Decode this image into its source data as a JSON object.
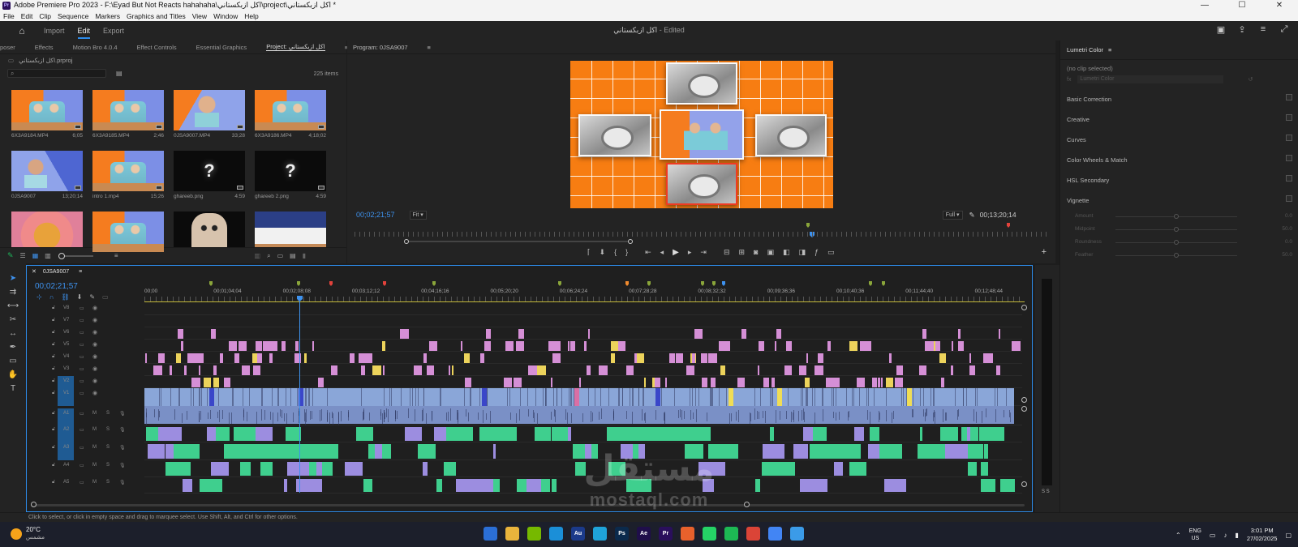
{
  "window": {
    "title": "Adobe Premiere Pro 2023 - F:\\Eyad But Not Reacts hahahaha\\اكل ازبكستاني\\project\\اكل ازبكستاني *",
    "app_icon": "Pr",
    "minimize": "—",
    "maximize": "☐",
    "close": "✕"
  },
  "menu": [
    "File",
    "Edit",
    "Clip",
    "Sequence",
    "Markers",
    "Graphics and Titles",
    "View",
    "Window",
    "Help"
  ],
  "header": {
    "tabs": [
      "Import",
      "Edit",
      "Export"
    ],
    "active_tab": "Edit",
    "project_name": "اكل ازبكستاني",
    "project_status": "- Edited"
  },
  "project_panel": {
    "tabs": [
      "poser",
      "Effects",
      "Motion Bro 4.0.4",
      "Effect Controls",
      "Essential Graphics",
      "Project: اكل ازبكستاني"
    ],
    "project_file": "اكل ازبكستاني.prproj",
    "search_placeholder": "",
    "item_count": "225 items",
    "items": [
      {
        "name": "6X3A9184.MP4",
        "duration": "6;05",
        "kind": "people"
      },
      {
        "name": "6X3A9185.MP4",
        "duration": "2;46",
        "kind": "people"
      },
      {
        "name": "0JSA9007.MP4",
        "duration": "33;28",
        "kind": "face"
      },
      {
        "name": "6X3A9186.MP4",
        "duration": "4;18;02",
        "kind": "people"
      },
      {
        "name": "0JSA9007",
        "duration": "13;20;14",
        "kind": "face2"
      },
      {
        "name": "intro 1.mp4",
        "duration": "15;26",
        "kind": "people"
      },
      {
        "name": "ghareeb.png",
        "duration": "4:59",
        "kind": "missing"
      },
      {
        "name": "ghareeb 2.png",
        "duration": "4:59",
        "kind": "missing"
      },
      {
        "name": "",
        "duration": "",
        "kind": "pink"
      },
      {
        "name": "",
        "duration": "",
        "kind": "people"
      },
      {
        "name": "",
        "duration": "",
        "kind": "cat"
      },
      {
        "name": "",
        "duration": "",
        "kind": "plate"
      }
    ]
  },
  "program_monitor": {
    "title": "Program: 0JSA9007",
    "timecode_current": "00;02;21;57",
    "fit": "Fit",
    "quality": "Full",
    "timecode_duration": "00;13;20;14"
  },
  "lumetri": {
    "title": "Lumetri Color",
    "no_clip": "(no clip selected)",
    "fx_label": "fx",
    "fx_value": "Lumetri Color",
    "sections": [
      "Basic Correction",
      "Creative",
      "Curves",
      "Color Wheels & Match",
      "HSL Secondary",
      "Vignette"
    ],
    "vignette_rows": [
      {
        "label": "Amount",
        "value": "0.0"
      },
      {
        "label": "Midpoint",
        "value": "50.0"
      },
      {
        "label": "Roundness",
        "value": "0.0"
      },
      {
        "label": "Feather",
        "value": "50.0"
      }
    ]
  },
  "timeline": {
    "sequence_tab": "0JSA9007",
    "timecode": "00;02;21;57",
    "ruler_labels": [
      "00;00",
      "00;01;04;04",
      "00;02;08;08",
      "00;03;12;12",
      "00;04;16;16",
      "00;05;20;20",
      "00;06;24;24",
      "00;07;28;28",
      "00;08;32;32",
      "00;09;36;36",
      "00;10;40;36",
      "00;11;44;40",
      "00;12;48;44"
    ],
    "video_tracks": [
      "V8",
      "V7",
      "V6",
      "V5",
      "V4",
      "V3",
      "V2",
      "V1"
    ],
    "audio_tracks": [
      "A1",
      "A2",
      "A3",
      "A4",
      "A5"
    ],
    "mute_label": "M",
    "solo_label": "S",
    "meter_labels": "S S"
  },
  "status_bar": "Click to select, or click in empty space and drag to marquee select. Use Shift, Alt, and Ctrl for other options.",
  "taskbar": {
    "temperature": "20°C",
    "weather_desc": "مشمس",
    "apps": [
      {
        "label": "",
        "color": "#2b6fd6"
      },
      {
        "label": "",
        "color": "#e9b43c"
      },
      {
        "label": "",
        "color": "#76b900"
      },
      {
        "label": "",
        "color": "#1b8fd8"
      },
      {
        "label": "Au",
        "color": "#1b3a8a"
      },
      {
        "label": "",
        "color": "#1fa3d9"
      },
      {
        "label": "Ps",
        "color": "#0b2a4c"
      },
      {
        "label": "Ae",
        "color": "#1f0e4a"
      },
      {
        "label": "Pr",
        "color": "#2a0f5c"
      },
      {
        "label": "",
        "color": "#e8612c"
      },
      {
        "label": "",
        "color": "#25d366"
      },
      {
        "label": "",
        "color": "#1db954"
      },
      {
        "label": "",
        "color": "#db4437"
      },
      {
        "label": "",
        "color": "#4285f4"
      },
      {
        "label": "",
        "color": "#3b9be8"
      }
    ],
    "lang": "ENG",
    "region": "US",
    "time": "3:01 PM",
    "date": "27/02/2025"
  },
  "watermark": {
    "arabic": "مستقل",
    "latin": "mostaql.com"
  }
}
